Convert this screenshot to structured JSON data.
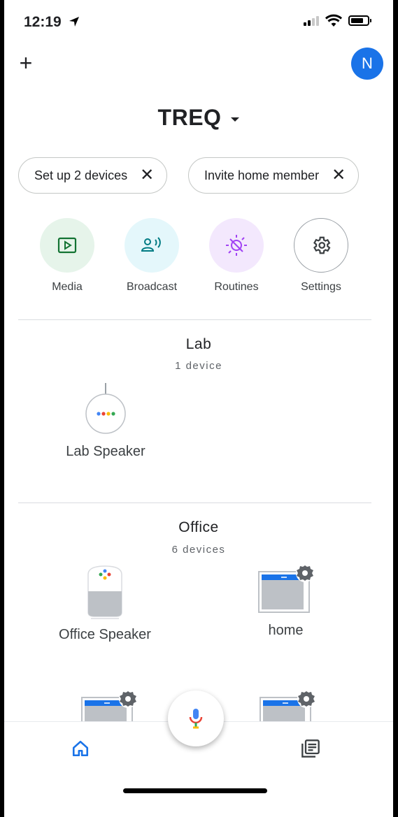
{
  "status_bar": {
    "time": "12:19"
  },
  "header": {
    "avatar_initial": "N",
    "home_name": "TREQ"
  },
  "chips": [
    {
      "label": "Set up 2 devices"
    },
    {
      "label": "Invite home member"
    }
  ],
  "actions": [
    {
      "label": "Media",
      "icon": "media-icon",
      "color": "#e6f4ea"
    },
    {
      "label": "Broadcast",
      "icon": "broadcast-icon",
      "color": "#e4f7fb"
    },
    {
      "label": "Routines",
      "icon": "routines-icon",
      "color": "#f3e8fd"
    },
    {
      "label": "Settings",
      "icon": "gear-icon",
      "color": "#ffffff"
    }
  ],
  "rooms": [
    {
      "name": "Lab",
      "count": "1 device",
      "devices": [
        {
          "label": "Lab Speaker",
          "icon": "speaker-mini-icon"
        }
      ]
    },
    {
      "name": "Office",
      "count": "6 devices",
      "devices": [
        {
          "label": "Office Speaker",
          "icon": "speaker-icon"
        },
        {
          "label": "home",
          "icon": "display-settings-icon"
        },
        {
          "label": "",
          "icon": "display-settings-icon"
        },
        {
          "label": "",
          "icon": "display-settings-icon"
        }
      ]
    }
  ],
  "bottom_nav": {
    "home_icon": "home-icon",
    "feed_icon": "feed-icon",
    "accent": "#1a73e8"
  }
}
